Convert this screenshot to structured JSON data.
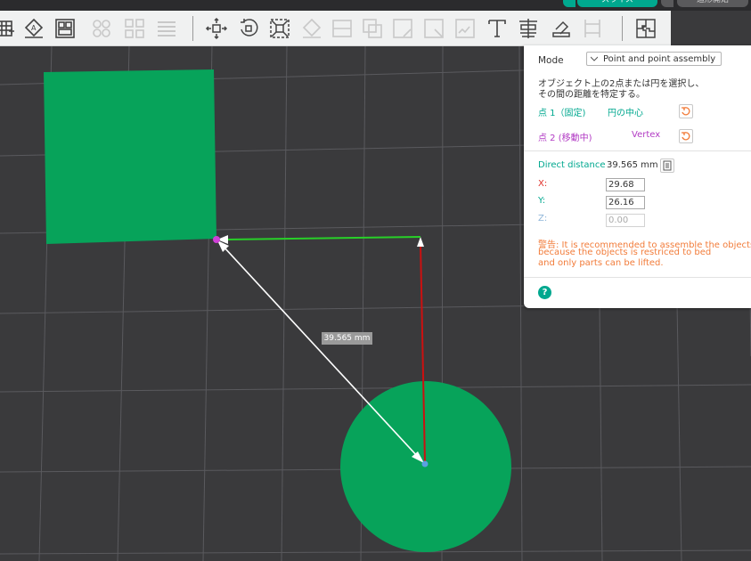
{
  "topbar": {
    "slice_label": "スライス",
    "export_label": "造形開始"
  },
  "toolbar": {
    "tools": [
      "grid-icon",
      "orient-icon",
      "arrange-icon",
      "split-objects-icon",
      "split-parts-icon",
      "layers-icon",
      "move-icon",
      "rotate-icon",
      "scale-icon",
      "lay-on-face-icon",
      "cut-icon",
      "boolean-icon",
      "support-paint-icon",
      "seam-paint-icon",
      "fuzzy-skin-icon",
      "text-icon",
      "measure-icon",
      "assembly-icon",
      "assemble-view-icon"
    ]
  },
  "panel": {
    "mode_label": "Mode",
    "mode_value": "Point and point assembly",
    "description_line1": "オブジェクト上の2点または円を選択し、",
    "description_line2": "その間の距離を特定する。",
    "point1_label": "点 1（固定)",
    "point1_value": "円の中心",
    "point2_label": "点 2 (移動中)",
    "point2_value": "Vertex",
    "direct_distance_label": "Direct distance",
    "direct_distance_value": "39.565 mm",
    "x_label": "X:",
    "x_value": "29.68",
    "y_label": "Y:",
    "y_value": "26.16",
    "z_label": "Z:",
    "z_value": "0.00",
    "warning_line1": "警告: It is recommended to assemble the objects first,",
    "warning_line2": "because the objects is restriced to bed",
    "warning_line3": "and only parts can be lifted.",
    "help_label": "?"
  },
  "viewport": {
    "distance_label": "39.565 mm",
    "colors": {
      "object": "#07a35a",
      "x_axis": "#28d028",
      "y_axis": "#cc1010",
      "distance_line": "#ffffff",
      "point2_marker": "#d040d8",
      "point1_marker": "#5aa0e0"
    }
  }
}
